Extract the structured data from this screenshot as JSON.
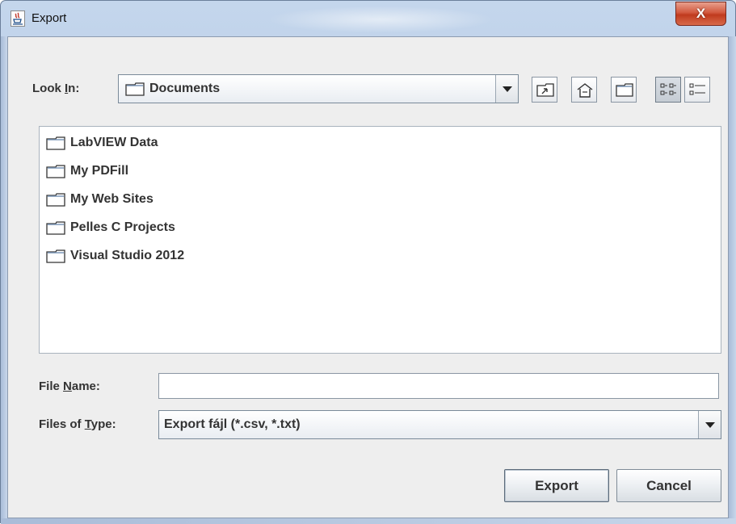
{
  "window": {
    "title": "Export",
    "close_label": "X"
  },
  "lookin": {
    "label_pre": "Look ",
    "label_u": "I",
    "label_post": "n:",
    "value": "Documents"
  },
  "toolbar": {
    "buttons": [
      {
        "icon": "up-one-level-icon"
      },
      {
        "icon": "home-icon"
      },
      {
        "icon": "new-folder-icon"
      },
      {
        "icon": "list-view-icon",
        "active": true
      },
      {
        "icon": "details-view-icon"
      }
    ]
  },
  "files": [
    {
      "name": "LabVIEW Data"
    },
    {
      "name": "My PDFill"
    },
    {
      "name": "My Web Sites"
    },
    {
      "name": "Pelles C Projects"
    },
    {
      "name": "Visual Studio 2012"
    }
  ],
  "filename": {
    "label_pre": "File ",
    "label_u": "N",
    "label_post": "ame:",
    "value": ""
  },
  "filetype": {
    "label_pre": "Files of ",
    "label_u": "T",
    "label_post": "ype:",
    "value": "Export fájl (*.csv, *.txt)"
  },
  "buttons": {
    "export": "Export",
    "cancel": "Cancel"
  }
}
